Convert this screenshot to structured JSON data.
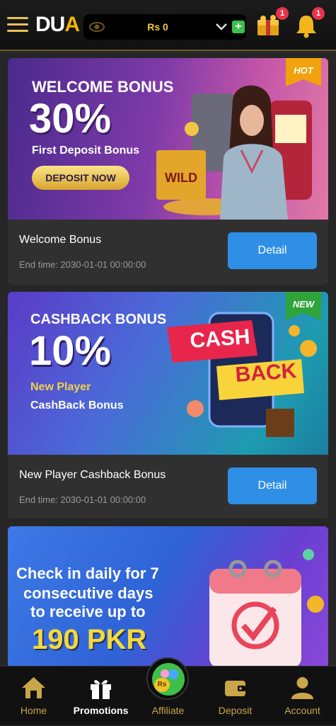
{
  "header": {
    "logo_du": "DU",
    "logo_a": "A",
    "balance": "Rs 0",
    "plus": "+",
    "gift_badge": "1",
    "bell_badge": "1"
  },
  "promotions": [
    {
      "tag": "HOT",
      "banner_line1": "WELCOME BONUS",
      "banner_line2": "30%",
      "banner_line3": "First Deposit Bonus",
      "banner_button": "DEPOSIT NOW",
      "title": "Welcome Bonus",
      "end_time": "End time: 2030-01-01 00:00:00",
      "detail_label": "Detail"
    },
    {
      "tag": "NEW",
      "banner_line1": "CASHBACK BONUS",
      "banner_line2": "10%",
      "banner_line3": "New Player",
      "banner_line4": "CashBack Bonus",
      "graphic_text1": "CASH",
      "graphic_text2": "BACK",
      "title": "New Player Cashback Bonus",
      "end_time": "End time: 2030-01-01 00:00:00",
      "detail_label": "Detail"
    },
    {
      "banner_line1": "Check in daily for 7",
      "banner_line2": "consecutive days",
      "banner_line3": "to receive up to",
      "banner_line4": "190 PKR"
    }
  ],
  "nav": {
    "home": "Home",
    "promotions": "Promotions",
    "affiliate": "Affiliate",
    "deposit": "Deposit",
    "account": "Account",
    "affiliate_coin": "Rs"
  }
}
